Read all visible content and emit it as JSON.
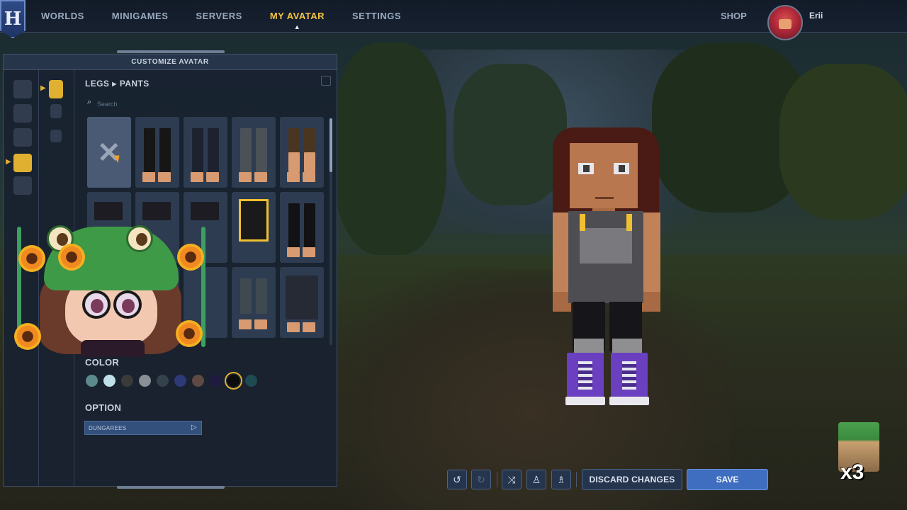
{
  "nav": {
    "logo": "H",
    "items": [
      "WORLDS",
      "MINIGAMES",
      "SERVERS",
      "MY AVATAR",
      "SETTINGS"
    ],
    "active": "MY AVATAR",
    "shop": "SHOP",
    "username": "Erii"
  },
  "panel": {
    "title": "CUSTOMIZE AVATAR",
    "breadcrumb": {
      "category": "LEGS",
      "subcategory": "PANTS"
    },
    "search_placeholder": "Search",
    "color_label": "COLOR",
    "option_label": "OPTION",
    "option_value": "DUNGAREES",
    "colors": [
      "#5a8a8c",
      "#bfe0e8",
      "#3a3a3a",
      "#8a8f96",
      "#34424c",
      "#2e3a78",
      "#5e4a42",
      "#1e1a40",
      "#0c0c0c",
      "#1f4a52"
    ],
    "selected_color_index": 8
  },
  "toolbar": {
    "discard": "DISCARD CHANGES",
    "save": "SAVE"
  },
  "sticker": {
    "count": "x3"
  }
}
